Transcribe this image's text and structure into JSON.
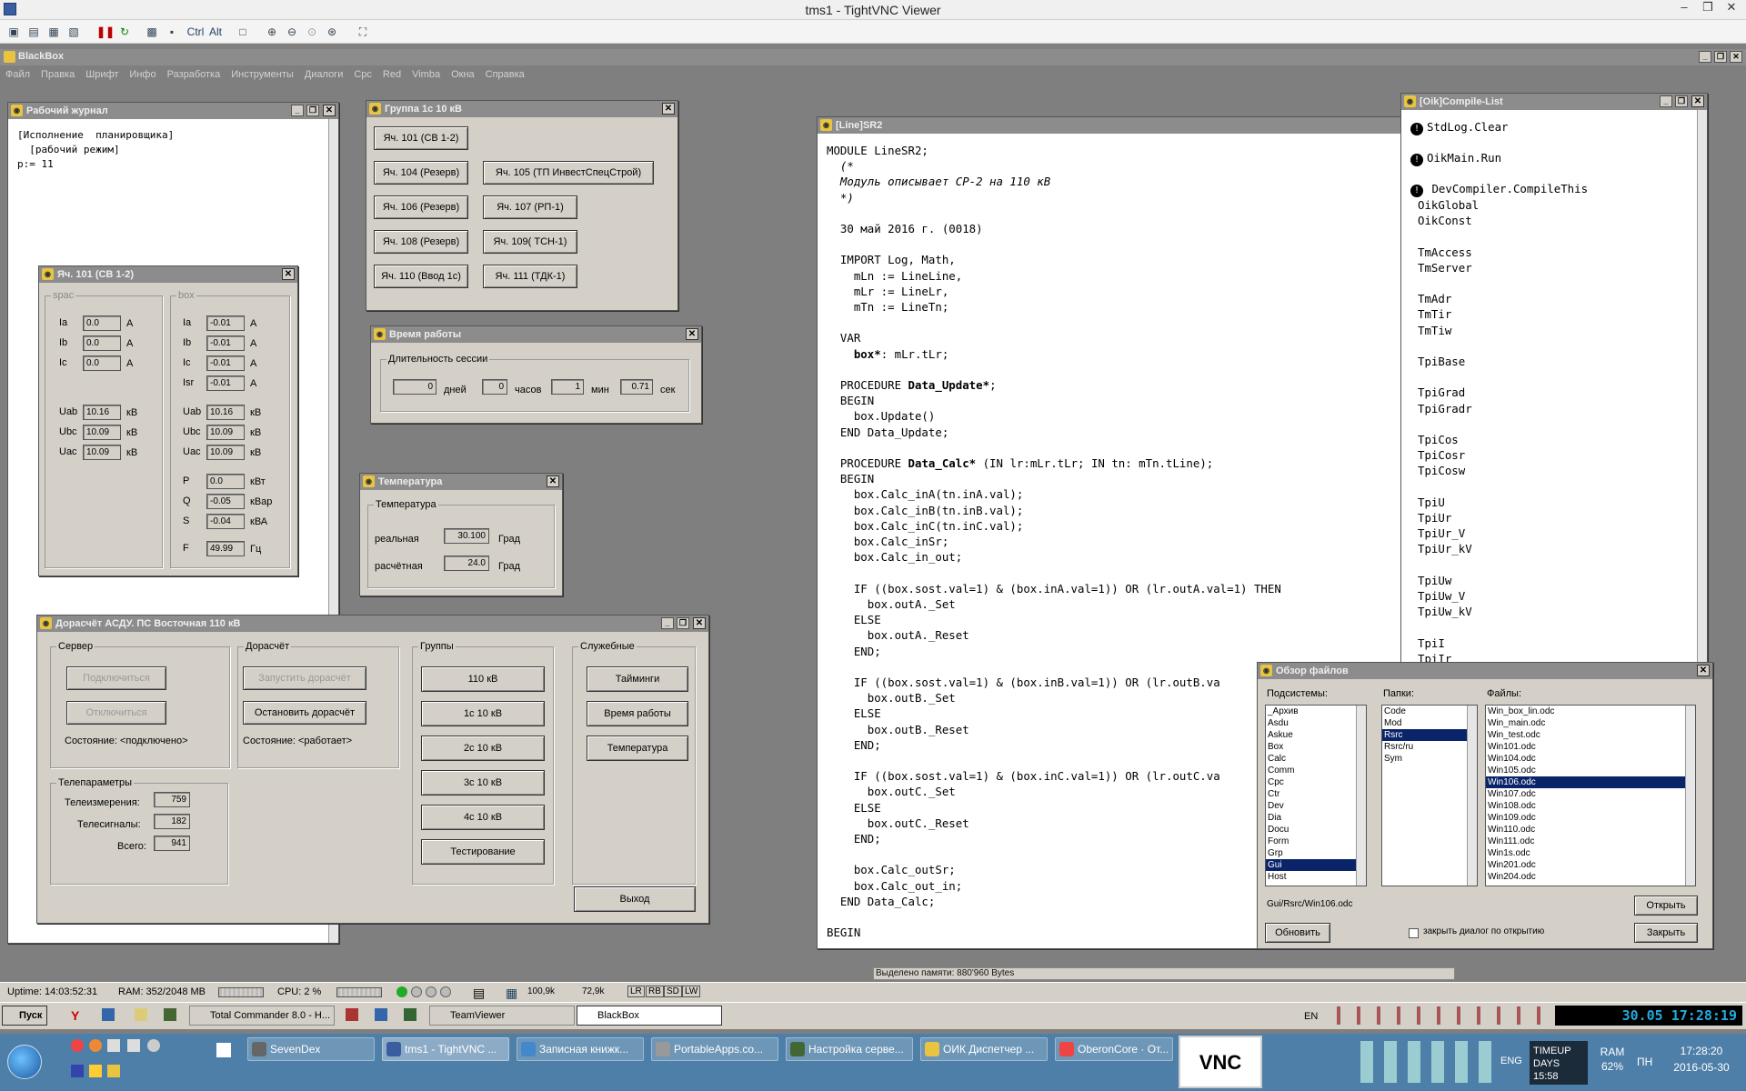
{
  "vnc": {
    "title": "tms1 - TightVNC Viewer",
    "toolbar_icons": [
      "new-connection",
      "save",
      "options",
      "info",
      "pause",
      "refresh",
      "ctrl-alt-del",
      "ctrl-esc",
      "Ctrl",
      "Alt",
      "clipboard",
      "zoom-in",
      "zoom-out",
      "zoom-100",
      "zoom-fit",
      "fullscreen"
    ],
    "ctrl_label": "Ctrl",
    "alt_label": "Alt"
  },
  "blackbox": {
    "title": "BlackBox",
    "menu": [
      "Файл",
      "Правка",
      "Шрифт",
      "Инфо",
      "Разработка",
      "Инструменты",
      "Диалоги",
      "Cpc",
      "Red",
      "Vimba",
      "Окна",
      "Справка"
    ]
  },
  "journal": {
    "title": "Рабочий журнал",
    "lines": [
      "[Исполнение  планировщика]",
      "  [рабочий режим]",
      "p:= 11"
    ]
  },
  "cell101": {
    "title": "Яч. 101 (СВ 1-2)",
    "spac_label": "spac",
    "box_label": "box",
    "spac": [
      {
        "n": "Ia",
        "v": "0.0",
        "u": "А"
      },
      {
        "n": "Ib",
        "v": "0.0",
        "u": "А"
      },
      {
        "n": "Ic",
        "v": "0.0",
        "u": "А"
      },
      {
        "n": "Uab",
        "v": "10.16",
        "u": "кВ"
      },
      {
        "n": "Ubc",
        "v": "10.09",
        "u": "кВ"
      },
      {
        "n": "Uac",
        "v": "10.09",
        "u": "кВ"
      }
    ],
    "box": [
      {
        "n": "Ia",
        "v": "-0.01",
        "u": "А"
      },
      {
        "n": "Ib",
        "v": "-0.01",
        "u": "А"
      },
      {
        "n": "Ic",
        "v": "-0.01",
        "u": "А"
      },
      {
        "n": "Isr",
        "v": "-0.01",
        "u": "А"
      },
      {
        "n": "Uab",
        "v": "10.16",
        "u": "кВ"
      },
      {
        "n": "Ubc",
        "v": "10.09",
        "u": "кВ"
      },
      {
        "n": "Uac",
        "v": "10.09",
        "u": "кВ"
      },
      {
        "n": "P",
        "v": "0.0",
        "u": "кВт"
      },
      {
        "n": "Q",
        "v": "-0.05",
        "u": "кВар"
      },
      {
        "n": "S",
        "v": "-0.04",
        "u": "кВА"
      },
      {
        "n": "F",
        "v": "49.99",
        "u": "Гц"
      }
    ]
  },
  "group1c": {
    "title": "Группа 1с 10 кВ",
    "buttons": [
      "Яч. 101 (СВ 1-2)",
      "Яч. 104 (Резерв)",
      "Яч. 105 (ТП ИнвестСпецСтрой)",
      "Яч. 106 (Резерв)",
      "Яч. 107 (РП-1)",
      "Яч. 108 (Резерв)",
      "Яч. 109( ТСН-1)",
      "Яч. 110 (Ввод 1с)",
      "Яч. 111 (ТДК-1)"
    ]
  },
  "worktime": {
    "title": "Время работы",
    "group": "Длительность сессии",
    "days": "0",
    "days_label": "дней",
    "hours": "0",
    "hours_label": "часов",
    "mins": "1",
    "mins_label": "мин",
    "secs": "0.71",
    "secs_label": "сек"
  },
  "temperature": {
    "title": "Температура",
    "group": "Температура",
    "real_label": "реальная",
    "real_value": "30.100",
    "real_unit": "Град",
    "calc_label": "расчётная",
    "calc_value": "24.0",
    "calc_unit": "Град"
  },
  "asdu": {
    "title": "Дорасчёт АСДУ. ПС Восточная 110 кВ",
    "server_group": "Сервер",
    "connect": "Подключиться",
    "disconnect": "Отключиться",
    "server_state": "Состояние: <подключено>",
    "calc_group": "Дорасчёт",
    "start_calc": "Запустить дорасчёт",
    "stop_calc": "Остановить дорасчёт",
    "calc_state": "Состояние: <работает>",
    "groups_group": "Группы",
    "groups": [
      "110 кВ",
      "1с 10 кВ",
      "2с 10 кВ",
      "3с 10 кВ",
      "4с 10 кВ",
      "Тестирование"
    ],
    "service_group": "Служебные",
    "service": [
      "Тайминги",
      "Время работы",
      "Температура"
    ],
    "tele_group": "Телепараметры",
    "tm_label": "Телеизмерения:",
    "tm_value": "759",
    "ts_label": "Телесигналы:",
    "ts_value": "182",
    "total_label": "Всего:",
    "total_value": "941",
    "exit": "Выход"
  },
  "code": {
    "title": "[Line]SR2",
    "lines": [
      "MODULE LineSR2;",
      "  (*",
      "  Модуль описывает СР-2 на 110 кВ",
      "  *)",
      "",
      "  30 май 2016 г. (0018)",
      "",
      "  IMPORT Log, Math,",
      "    mLn := LineLine,",
      "    mLr := LineLr,",
      "    mTn := LineTn;",
      "",
      "  VAR",
      "    box*: mLr.tLr;",
      "",
      "  PROCEDURE Data_Update*;",
      "  BEGIN",
      "    box.Update()",
      "  END Data_Update;",
      "",
      "  PROCEDURE Data_Calc* (IN lr:mLr.tLr; IN tn: mTn.tLine);",
      "  BEGIN",
      "    box.Calc_inA(tn.inA.val);",
      "    box.Calc_inB(tn.inB.val);",
      "    box.Calc_inC(tn.inC.val);",
      "    box.Calc_inSr;",
      "    box.Calc_in_out;",
      "",
      "    IF ((box.sost.val=1) & (box.inA.val=1)) OR (lr.outA.val=1) THEN",
      "      box.outA._Set",
      "    ELSE",
      "      box.outA._Reset",
      "    END;",
      "",
      "    IF ((box.sost.val=1) & (box.inB.val=1)) OR (lr.outB.va",
      "      box.outB._Set",
      "    ELSE",
      "      box.outB._Reset",
      "    END;",
      "",
      "    IF ((box.sost.val=1) & (box.inC.val=1)) OR (lr.outC.va",
      "      box.outC._Set",
      "    ELSE",
      "      box.outC._Reset",
      "    END;",
      "",
      "    box.Calc_outSr;",
      "    box.Calc_out_in;",
      "  END Data_Calc;",
      "",
      "BEGIN"
    ]
  },
  "compile": {
    "title": "[Oik]Compile-List",
    "cmd1": "StdLog.Clear",
    "cmd2": "OikMain.Run",
    "cmd3": " DevCompiler.CompileThis",
    "modules": "OikGlobal\nOikConst\n\nTmAccess\nTmServer\n\nTmAdr\nTmTir\nTmTiw\n\nTpiBase\n\nTpiGrad\nTpiGradr\n\nTpiCos\nTpiCosr\nTpiCosw\n\nTpiU\nTpiUr\nTpiUr_V\nTpiUr_kV\n\nTpiUw\nTpiUw_V\nTpiUw_kV\n\nTpiI\nTpiIr"
  },
  "files": {
    "title": "Обзор файлов",
    "subsystems_label": "Подсистемы:",
    "folders_label": "Папки:",
    "files_label": "Файлы:",
    "subsystems": [
      "_Архив",
      "Asdu",
      "Askue",
      "Box",
      "Calc",
      "Comm",
      "Cpc",
      "Ctr",
      "Dev",
      "Dia",
      "Docu",
      "Form",
      "Grp",
      "Gui",
      "Host"
    ],
    "subsystems_selected": "Gui",
    "folders": [
      "Code",
      "Mod",
      "Rsrc",
      "Rsrc/ru",
      "Sym"
    ],
    "folders_selected": "Rsrc",
    "files": [
      "Win_box_lin.odc",
      "Win_main.odc",
      "Win_test.odc",
      "Win101.odc",
      "Win104.odc",
      "Win105.odc",
      "Win106.odc",
      "Win107.odc",
      "Win108.odc",
      "Win109.odc",
      "Win110.odc",
      "Win111.odc",
      "Win1s.odc",
      "Win201.odc",
      "Win204.odc"
    ],
    "files_selected": "Win106.odc",
    "path": "Gui/Rsrc/Win106.odc",
    "open": "Открыть",
    "refresh": "Обновить",
    "close_on_open": "закрыть диалог по открытию",
    "close": "Закрыть"
  },
  "memory": "Выделено памяти: 880'960 Bytes",
  "status": {
    "uptime": "Uptime: 14:03:52:31",
    "ram": "RAM:  352/2048 MB",
    "cpu": "CPU:    2 %",
    "net_down": "100,9k",
    "net_up": "72,9k",
    "flags": [
      "LR",
      "RB",
      "SD",
      "LW"
    ]
  },
  "taskbar": {
    "start": "Пуск",
    "tasks": [
      "Total Commander 8.0 - H...",
      "TeamViewer",
      "BlackBox"
    ],
    "active": "BlackBox",
    "lang": "EN",
    "clock": "30.05 17:28:19"
  },
  "win7": {
    "tasks": [
      "SevenDex",
      "tms1 - TightVNC ...",
      "Записная книжк...",
      "PortableApps.co...",
      "Настройка серве...",
      "ОИК Диспетчер ...",
      "OberonCore · От..."
    ],
    "timeup": "TIMEUP",
    "days": "DAYS 15:58",
    "ram_label": "RAM",
    "ram_value": "62%",
    "lang": "ENG",
    "day": "ПН",
    "time": "17:28:20",
    "date": "2016-05-30"
  }
}
